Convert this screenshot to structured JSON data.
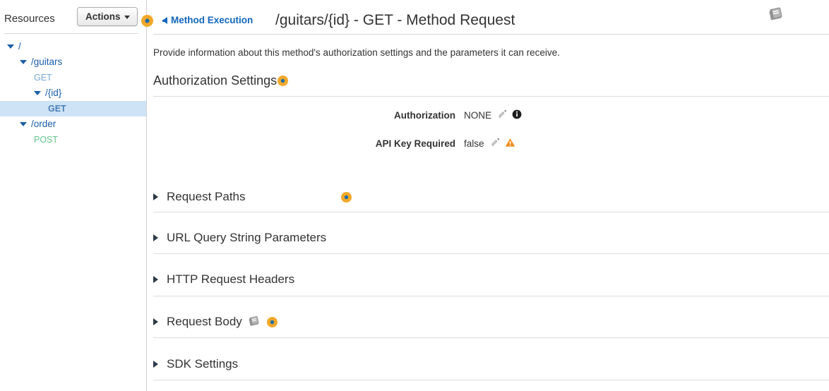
{
  "sidebar": {
    "title": "Resources",
    "actions_button": {
      "label": "Actions",
      "icon": "chevron-down-icon"
    },
    "tree": [
      {
        "label": "/",
        "type": "resource",
        "depth": 0,
        "expanded": true,
        "selected": false
      },
      {
        "label": "/guitars",
        "type": "resource",
        "depth": 1,
        "expanded": true,
        "selected": false
      },
      {
        "label": "GET",
        "type": "method",
        "depth": 2,
        "method": "GET",
        "selected": false
      },
      {
        "label": "/{id}",
        "type": "resource",
        "depth": 2,
        "expanded": true,
        "selected": false
      },
      {
        "label": "GET",
        "type": "method",
        "depth": 3,
        "method": "GET",
        "selected": true
      },
      {
        "label": "/order",
        "type": "resource",
        "depth": 1,
        "expanded": true,
        "selected": false
      },
      {
        "label": "POST",
        "type": "method",
        "depth": 2,
        "method": "POST",
        "selected": false
      }
    ]
  },
  "header": {
    "back_link": "Method Execution",
    "back_icon": "arrow-left-icon",
    "title": "/guitars/{id} - GET - Method Request",
    "docs_icon": "book-icon"
  },
  "main": {
    "intro": "Provide information about this method's authorization settings and the parameters it can receive.",
    "authorization_section": {
      "title": "Authorization Settings",
      "marker_icon": "orange-marker-dot-icon",
      "rows": [
        {
          "label": "Authorization",
          "value": "NONE",
          "edit_icon": "pencil-icon",
          "status_icon": "info-icon"
        },
        {
          "label": "API Key Required",
          "value": "false",
          "edit_icon": "pencil-icon",
          "status_icon": "warning-icon"
        }
      ]
    },
    "sections": [
      {
        "label": "Request Paths",
        "expand_icon": "triangle-right-icon",
        "has_marker": true,
        "has_book": false
      },
      {
        "label": "URL Query String Parameters",
        "expand_icon": "triangle-right-icon",
        "has_marker": false,
        "has_book": false
      },
      {
        "label": "HTTP Request Headers",
        "expand_icon": "triangle-right-icon",
        "has_marker": false,
        "has_book": false
      },
      {
        "label": "Request Body",
        "expand_icon": "triangle-right-icon",
        "has_marker": true,
        "has_book": true
      },
      {
        "label": "SDK Settings",
        "expand_icon": "triangle-right-icon",
        "has_marker": false,
        "has_book": false
      }
    ]
  },
  "colors": {
    "link_blue": "#1166bb",
    "resource_blue": "#1b5eab",
    "get_green_blue": "#7ba7d4",
    "post_green": "#63c48a",
    "selection_bg": "#cfe3f7",
    "marker_orange": "#f4a82a",
    "warning_orange": "#f08c1b",
    "text_dark": "#333333"
  }
}
